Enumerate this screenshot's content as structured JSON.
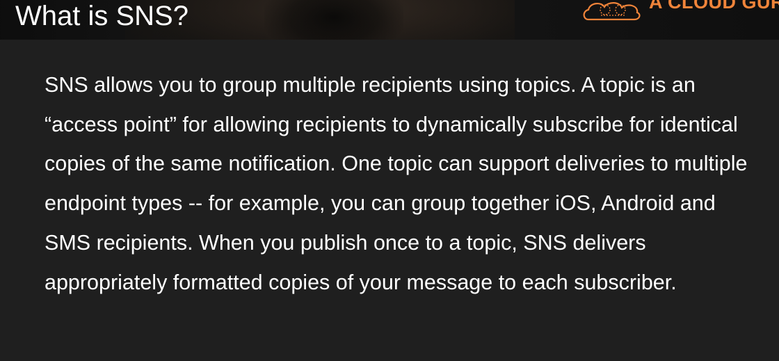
{
  "slide": {
    "title": "What is SNS?",
    "logo": {
      "text": "A CLOUD GURU",
      "icon": "cloud-guru-logo-icon",
      "color": "#f0843a"
    },
    "body": "SNS allows you to group multiple recipients using topics. A topic is an “access point” for allowing recipients to dynamically subscribe for identical copies of the same notification. One topic can support deliveries to multiple endpoint types -- for example, you can group together iOS, Android and SMS recipients. When you publish once to a topic, SNS delivers appropriately formatted copies of your message to each subscriber."
  },
  "colors": {
    "background": "#1f1f1f",
    "header": "#151515",
    "text": "#ffffff",
    "accent": "#f0843a"
  }
}
